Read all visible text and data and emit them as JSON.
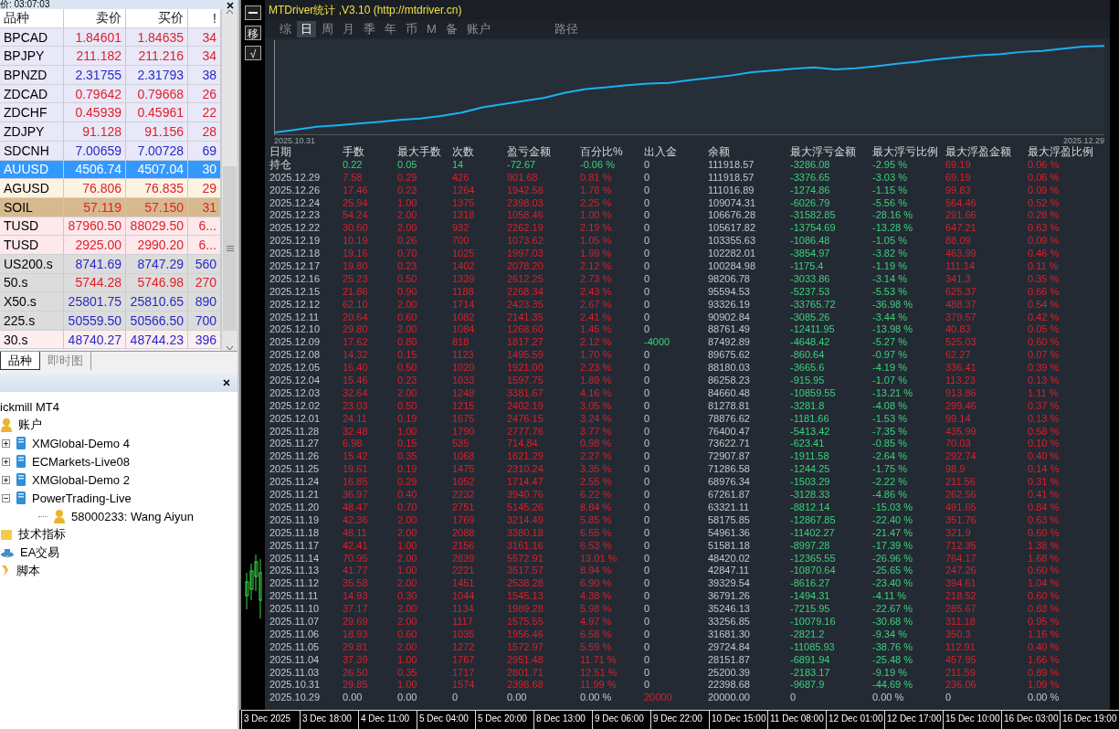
{
  "market_watch": {
    "title": "价: 03:07:03",
    "columns": [
      "品种",
      "卖价",
      "买价",
      "!"
    ],
    "rows": [
      {
        "symbol": "BPCAD",
        "bid": "1.84601",
        "ask": "1.84635",
        "spread": "34",
        "rising": false,
        "color": "#e8e8f8",
        "selected": false
      },
      {
        "symbol": "BPJPY",
        "bid": "211.182",
        "ask": "211.216",
        "spread": "34",
        "rising": false,
        "color": "#e8e8f8",
        "selected": false
      },
      {
        "symbol": "BPNZD",
        "bid": "2.31755",
        "ask": "2.31793",
        "spread": "38",
        "rising": true,
        "color": "#e8e8f8",
        "selected": false
      },
      {
        "symbol": "ZDCAD",
        "bid": "0.79642",
        "ask": "0.79668",
        "spread": "26",
        "rising": false,
        "color": "#e8e8f8",
        "selected": false
      },
      {
        "symbol": "ZDCHF",
        "bid": "0.45939",
        "ask": "0.45961",
        "spread": "22",
        "rising": false,
        "color": "#e8e8f8",
        "selected": false
      },
      {
        "symbol": "ZDJPY",
        "bid": "91.128",
        "ask": "91.156",
        "spread": "28",
        "rising": false,
        "color": "#e8e8f8",
        "selected": false
      },
      {
        "symbol": "SDCNH",
        "bid": "7.00659",
        "ask": "7.00728",
        "spread": "69",
        "rising": true,
        "color": "#e8e8f8",
        "selected": false
      },
      {
        "symbol": "AUUSD",
        "bid": "4506.74",
        "ask": "4507.04",
        "spread": "30",
        "selected": true
      },
      {
        "symbol": "AGUSD",
        "bid": "76.806",
        "ask": "76.835",
        "spread": "29",
        "rising": false,
        "color": "#fdf3e2",
        "selected": false
      },
      {
        "symbol": "SOIL",
        "bid": "57.119",
        "ask": "57.150",
        "spread": "31",
        "rising": false,
        "color": "#d7b98e",
        "selected": false
      },
      {
        "symbol": "TUSD",
        "bid": "87960.50",
        "ask": "88029.50",
        "spread": "6...",
        "rising": false,
        "color": "#fde8ec",
        "selected": false
      },
      {
        "symbol": "TUSD",
        "bid": "2925.00",
        "ask": "2990.20",
        "spread": "6...",
        "rising": false,
        "color": "#fde8ec",
        "selected": false
      },
      {
        "symbol": "US200.s",
        "bid": "8741.69",
        "ask": "8747.29",
        "spread": "560",
        "rising": true,
        "color": "#dcdcdc",
        "selected": false
      },
      {
        "symbol": "50.s",
        "bid": "5744.28",
        "ask": "5746.98",
        "spread": "270",
        "rising": false,
        "color": "#dcdcdc",
        "selected": false
      },
      {
        "symbol": "X50.s",
        "bid": "25801.75",
        "ask": "25810.65",
        "spread": "890",
        "rising": true,
        "color": "#dcdcdc",
        "selected": false
      },
      {
        "symbol": "225.s",
        "bid": "50559.50",
        "ask": "50566.50",
        "spread": "700",
        "rising": true,
        "color": "#dcdcdc",
        "selected": false
      },
      {
        "symbol": "30.s",
        "bid": "48740.27",
        "ask": "48744.23",
        "spread": "396",
        "rising": true,
        "color": "#fdeef0",
        "selected": false
      }
    ],
    "tabs": [
      {
        "label": "品种",
        "selected": true
      },
      {
        "label": "即时图",
        "selected": false
      }
    ]
  },
  "navigator": {
    "items": [
      {
        "label": "ickmill MT4",
        "kind": "root"
      },
      {
        "label": "账户",
        "kind": "accounts",
        "children": [
          {
            "label": "XMGlobal-Demo 4",
            "kind": "server",
            "expanded": false
          },
          {
            "label": "ECMarkets-Live08",
            "kind": "server",
            "expanded": false
          },
          {
            "label": "XMGlobal-Demo 2",
            "kind": "server",
            "expanded": false
          },
          {
            "label": "PowerTrading-Live",
            "kind": "server",
            "expanded": true,
            "children": [
              {
                "label": "58000233: Wang Aiyun",
                "kind": "user"
              }
            ]
          }
        ]
      },
      {
        "label": "技术指标",
        "kind": "indicators"
      },
      {
        "label": "EA交易",
        "kind": "experts"
      },
      {
        "label": "脚本",
        "kind": "scripts"
      }
    ]
  },
  "stats_panel": {
    "title": "MTDriver统计 ,V3.10 (http://mtdriver.cn)",
    "side_buttons": [
      "移",
      "√"
    ],
    "tabs": [
      {
        "label": "综",
        "selected": false
      },
      {
        "label": "日",
        "selected": true
      },
      {
        "label": "周",
        "selected": false
      },
      {
        "label": "月",
        "selected": false
      },
      {
        "label": "季",
        "selected": false
      },
      {
        "label": "年",
        "selected": false
      },
      {
        "label": "币",
        "selected": false
      },
      {
        "label": "M",
        "selected": false
      },
      {
        "label": "备",
        "selected": false
      },
      {
        "label": "账户",
        "selected": false
      },
      {
        "label": "路径",
        "selected": false
      }
    ],
    "chart": {
      "start_label": "2025.10.31",
      "end_label": "2025.12.29"
    },
    "columns": [
      "日期",
      "手数",
      "最大手数",
      "次数",
      "盈亏金额",
      "百分比%",
      "出入金",
      "余额",
      "最大浮亏金额",
      "最大浮亏比例",
      "最大浮盈金额",
      "最大浮盈比例"
    ],
    "rows": [
      {
        "kind": "open",
        "deposit": false,
        "withdrawal": false,
        "cells": [
          "持仓",
          "0.22",
          "0.05",
          "14",
          "-72.67",
          "-0.06 %",
          "0",
          "111918.57",
          "-3286.08",
          "-2.95 %",
          "69.19",
          "0.06 %"
        ]
      },
      {
        "kind": "day",
        "deposit": false,
        "withdrawal": false,
        "cells": [
          "2025.12.29",
          "7.58",
          "0.29",
          "426",
          "901.68",
          "0.81 %",
          "0",
          "111918.57",
          "-3376.65",
          "-3.03 %",
          "69.19",
          "0.06 %"
        ]
      },
      {
        "kind": "day",
        "deposit": false,
        "withdrawal": false,
        "cells": [
          "2025.12.26",
          "17.46",
          "0.23",
          "1264",
          "1942.58",
          "1.78 %",
          "0",
          "111016.89",
          "-1274.86",
          "-1.15 %",
          "99.83",
          "0.09 %"
        ]
      },
      {
        "kind": "day",
        "deposit": false,
        "withdrawal": false,
        "cells": [
          "2025.12.24",
          "25.94",
          "1.00",
          "1375",
          "2398.03",
          "2.25 %",
          "0",
          "109074.31",
          "-6026.79",
          "-5.56 %",
          "564.46",
          "0.52 %"
        ]
      },
      {
        "kind": "day",
        "deposit": false,
        "withdrawal": false,
        "cells": [
          "2025.12.23",
          "54.24",
          "2.00",
          "1318",
          "1058.46",
          "1.00 %",
          "0",
          "106676.28",
          "-31582.85",
          "-28.16 %",
          "291.66",
          "0.28 %"
        ]
      },
      {
        "kind": "day",
        "deposit": false,
        "withdrawal": false,
        "cells": [
          "2025.12.22",
          "30.60",
          "2.00",
          "932",
          "2262.19",
          "2.19 %",
          "0",
          "105617.82",
          "-13754.69",
          "-13.28 %",
          "647.21",
          "0.63 %"
        ]
      },
      {
        "kind": "day",
        "deposit": false,
        "withdrawal": false,
        "cells": [
          "2025.12.19",
          "10.19",
          "0.26",
          "700",
          "1073.62",
          "1.05 %",
          "0",
          "103355.63",
          "-1086.48",
          "-1.05 %",
          "88.09",
          "0.09 %"
        ]
      },
      {
        "kind": "day",
        "deposit": false,
        "withdrawal": false,
        "cells": [
          "2025.12.18",
          "19.16",
          "0.70",
          "1025",
          "1997.03",
          "1.99 %",
          "0",
          "102282.01",
          "-3854.97",
          "-3.82 %",
          "463.99",
          "0.46 %"
        ]
      },
      {
        "kind": "day",
        "deposit": false,
        "withdrawal": false,
        "cells": [
          "2025.12.17",
          "19.80",
          "0.23",
          "1402",
          "2078.20",
          "2.12 %",
          "0",
          "100284.98",
          "-1175.4",
          "-1.19 %",
          "111.14",
          "0.11 %"
        ]
      },
      {
        "kind": "day",
        "deposit": false,
        "withdrawal": false,
        "cells": [
          "2025.12.16",
          "25.23",
          "0.50",
          "1339",
          "2612.25",
          "2.73 %",
          "0",
          "98206.78",
          "-3033.86",
          "-3.14 %",
          "341.3",
          "0.35 %"
        ]
      },
      {
        "kind": "day",
        "deposit": false,
        "withdrawal": false,
        "cells": [
          "2025.12.15",
          "21.86",
          "0.90",
          "1188",
          "2268.34",
          "2.43 %",
          "0",
          "95594.53",
          "-5237.53",
          "-5.53 %",
          "625.37",
          "0.66 %"
        ]
      },
      {
        "kind": "day",
        "deposit": false,
        "withdrawal": false,
        "cells": [
          "2025.12.12",
          "62.10",
          "2.00",
          "1714",
          "2423.35",
          "2.67 %",
          "0",
          "93326.19",
          "-33765.72",
          "-36.98 %",
          "488.37",
          "0.54 %"
        ]
      },
      {
        "kind": "day",
        "deposit": false,
        "withdrawal": false,
        "cells": [
          "2025.12.11",
          "20.64",
          "0.60",
          "1082",
          "2141.35",
          "2.41 %",
          "0",
          "90902.84",
          "-3085.26",
          "-3.44 %",
          "379.57",
          "0.42 %"
        ]
      },
      {
        "kind": "day",
        "deposit": false,
        "withdrawal": false,
        "cells": [
          "2025.12.10",
          "29.80",
          "2.00",
          "1084",
          "1268.60",
          "1.45 %",
          "0",
          "88761.49",
          "-12411.95",
          "-13.98 %",
          "40.83",
          "0.05 %"
        ]
      },
      {
        "kind": "day",
        "deposit": false,
        "withdrawal": true,
        "cells": [
          "2025.12.09",
          "17.62",
          "0.80",
          "818",
          "1817.27",
          "2.12 %",
          "-4000",
          "87492.89",
          "-4648.42",
          "-5.27 %",
          "525.03",
          "0.60 %"
        ]
      },
      {
        "kind": "day",
        "deposit": false,
        "withdrawal": false,
        "cells": [
          "2025.12.08",
          "14.32",
          "0.15",
          "1123",
          "1495.59",
          "1.70 %",
          "0",
          "89675.62",
          "-860.64",
          "-0.97 %",
          "62.27",
          "0.07 %"
        ]
      },
      {
        "kind": "day",
        "deposit": false,
        "withdrawal": false,
        "cells": [
          "2025.12.05",
          "16.40",
          "0.50",
          "1020",
          "1921.00",
          "2.23 %",
          "0",
          "88180.03",
          "-3665.6",
          "-4.19 %",
          "336.41",
          "0.39 %"
        ]
      },
      {
        "kind": "day",
        "deposit": false,
        "withdrawal": false,
        "cells": [
          "2025.12.04",
          "15.46",
          "0.23",
          "1033",
          "1597.75",
          "1.89 %",
          "0",
          "86258.23",
          "-915.95",
          "-1.07 %",
          "113.23",
          "0.13 %"
        ]
      },
      {
        "kind": "day",
        "deposit": false,
        "withdrawal": false,
        "cells": [
          "2025.12.03",
          "32.64",
          "2.00",
          "1248",
          "3381.67",
          "4.16 %",
          "0",
          "84660.48",
          "-10859.55",
          "-13.21 %",
          "913.86",
          "1.11 %"
        ]
      },
      {
        "kind": "day",
        "deposit": false,
        "withdrawal": false,
        "cells": [
          "2025.12.02",
          "23.03",
          "0.50",
          "1215",
          "2402.19",
          "3.05 %",
          "0",
          "81278.81",
          "-3281.8",
          "-4.08 %",
          "299.46",
          "0.37 %"
        ]
      },
      {
        "kind": "day",
        "deposit": false,
        "withdrawal": false,
        "cells": [
          "2025.12.01",
          "24.11",
          "0.19",
          "1675",
          "2476.15",
          "3.24 %",
          "0",
          "78876.62",
          "-1181.66",
          "-1.53 %",
          "99.14",
          "0.13 %"
        ]
      },
      {
        "kind": "day",
        "deposit": false,
        "withdrawal": false,
        "cells": [
          "2025.11.28",
          "32.48",
          "1.00",
          "1790",
          "2777.76",
          "3.77 %",
          "0",
          "76400.47",
          "-5413.42",
          "-7.35 %",
          "435.99",
          "0.58 %"
        ]
      },
      {
        "kind": "day",
        "deposit": false,
        "withdrawal": false,
        "cells": [
          "2025.11.27",
          "6.98",
          "0.15",
          "535",
          "714.84",
          "0.98 %",
          "0",
          "73622.71",
          "-623.41",
          "-0.85 %",
          "70.03",
          "0.10 %"
        ]
      },
      {
        "kind": "day",
        "deposit": false,
        "withdrawal": false,
        "cells": [
          "2025.11.26",
          "15.42",
          "0.35",
          "1068",
          "1621.29",
          "2.27 %",
          "0",
          "72907.87",
          "-1911.58",
          "-2.64 %",
          "292.74",
          "0.40 %"
        ]
      },
      {
        "kind": "day",
        "deposit": false,
        "withdrawal": false,
        "cells": [
          "2025.11.25",
          "19.61",
          "0.19",
          "1475",
          "2310.24",
          "3.35 %",
          "0",
          "71286.58",
          "-1244.25",
          "-1.75 %",
          "98.9",
          "0.14 %"
        ]
      },
      {
        "kind": "day",
        "deposit": false,
        "withdrawal": false,
        "cells": [
          "2025.11.24",
          "16.85",
          "0.29",
          "1052",
          "1714.47",
          "2.55 %",
          "0",
          "68976.34",
          "-1503.29",
          "-2.22 %",
          "211.56",
          "0.31 %"
        ]
      },
      {
        "kind": "day",
        "deposit": false,
        "withdrawal": false,
        "cells": [
          "2025.11.21",
          "36.97",
          "0.40",
          "2232",
          "3940.76",
          "6.22 %",
          "0",
          "67261.87",
          "-3128.33",
          "-4.86 %",
          "262.56",
          "0.41 %"
        ]
      },
      {
        "kind": "day",
        "deposit": false,
        "withdrawal": false,
        "cells": [
          "2025.11.20",
          "48.47",
          "0.70",
          "2751",
          "5145.26",
          "8.84 %",
          "0",
          "63321.11",
          "-8812.14",
          "-15.03 %",
          "491.65",
          "0.84 %"
        ]
      },
      {
        "kind": "day",
        "deposit": false,
        "withdrawal": false,
        "cells": [
          "2025.11.19",
          "42.36",
          "2.00",
          "1769",
          "3214.49",
          "5.85 %",
          "0",
          "58175.85",
          "-12867.85",
          "-22.40 %",
          "351.76",
          "0.63 %"
        ]
      },
      {
        "kind": "day",
        "deposit": false,
        "withdrawal": false,
        "cells": [
          "2025.11.18",
          "48.11",
          "2.00",
          "2088",
          "3380.18",
          "6.55 %",
          "0",
          "54961.36",
          "-11402.27",
          "-21.47 %",
          "321.9",
          "0.60 %"
        ]
      },
      {
        "kind": "day",
        "deposit": false,
        "withdrawal": false,
        "cells": [
          "2025.11.17",
          "42.41",
          "1.00",
          "2156",
          "3161.16",
          "6.53 %",
          "0",
          "51581.18",
          "-8997.28",
          "-17.39 %",
          "712.35",
          "1.38 %"
        ]
      },
      {
        "kind": "day",
        "deposit": false,
        "withdrawal": false,
        "cells": [
          "2025.11.14",
          "70.95",
          "2.00",
          "2839",
          "5572.91",
          "13.01 %",
          "0",
          "48420.02",
          "-12365.55",
          "-26.96 %",
          "764.17",
          "1.68 %"
        ]
      },
      {
        "kind": "day",
        "deposit": false,
        "withdrawal": false,
        "cells": [
          "2025.11.13",
          "41.77",
          "1.00",
          "2221",
          "3517.57",
          "8.94 %",
          "0",
          "42847.11",
          "-10870.64",
          "-25.65 %",
          "247.26",
          "0.60 %"
        ]
      },
      {
        "kind": "day",
        "deposit": false,
        "withdrawal": false,
        "cells": [
          "2025.11.12",
          "35.58",
          "2.00",
          "1451",
          "2538.28",
          "6.90 %",
          "0",
          "39329.54",
          "-8616.27",
          "-23.40 %",
          "394.61",
          "1.04 %"
        ]
      },
      {
        "kind": "day",
        "deposit": false,
        "withdrawal": false,
        "cells": [
          "2025.11.11",
          "14.93",
          "0.30",
          "1044",
          "1545.13",
          "4.38 %",
          "0",
          "36791.26",
          "-1494.31",
          "-4.11 %",
          "218.52",
          "0.60 %"
        ]
      },
      {
        "kind": "day",
        "deposit": false,
        "withdrawal": false,
        "cells": [
          "2025.11.10",
          "37.17",
          "2.00",
          "1134",
          "1989.28",
          "5.98 %",
          "0",
          "35246.13",
          "-7215.95",
          "-22.67 %",
          "285.67",
          "0.83 %"
        ]
      },
      {
        "kind": "day",
        "deposit": false,
        "withdrawal": false,
        "cells": [
          "2025.11.07",
          "29.69",
          "2.00",
          "1117",
          "1575.55",
          "4.97 %",
          "0",
          "33256.85",
          "-10079.16",
          "-30.68 %",
          "311.18",
          "0.95 %"
        ]
      },
      {
        "kind": "day",
        "deposit": false,
        "withdrawal": false,
        "cells": [
          "2025.11.06",
          "18.93",
          "0.60",
          "1035",
          "1956.46",
          "6.58 %",
          "0",
          "31681.30",
          "-2821.2",
          "-9.34 %",
          "350.3",
          "1.16 %"
        ]
      },
      {
        "kind": "day",
        "deposit": false,
        "withdrawal": false,
        "cells": [
          "2025.11.05",
          "29.81",
          "2.00",
          "1272",
          "1572.97",
          "5.59 %",
          "0",
          "29724.84",
          "-11085.93",
          "-38.76 %",
          "112.91",
          "0.40 %"
        ]
      },
      {
        "kind": "day",
        "deposit": false,
        "withdrawal": false,
        "cells": [
          "2025.11.04",
          "37.39",
          "1.00",
          "1767",
          "2951.48",
          "11.71 %",
          "0",
          "28151.87",
          "-6891.94",
          "-25.48 %",
          "457.95",
          "1.66 %"
        ]
      },
      {
        "kind": "day",
        "deposit": false,
        "withdrawal": false,
        "cells": [
          "2025.11.03",
          "26.50",
          "0.35",
          "1717",
          "2801.71",
          "12.51 %",
          "0",
          "25200.39",
          "-2183.17",
          "-9.19 %",
          "211.59",
          "0.89 %"
        ]
      },
      {
        "kind": "day",
        "deposit": false,
        "withdrawal": false,
        "cells": [
          "2025.10.31",
          "29.85",
          "1.00",
          "1574",
          "2398.68",
          "11.99 %",
          "0",
          "22398.68",
          "-9687.9",
          "-44.69 %",
          "236.06",
          "1.09 %"
        ]
      },
      {
        "kind": "start",
        "deposit": true,
        "withdrawal": false,
        "cells": [
          "2025.10.29",
          "0.00",
          "0.00",
          "0",
          "0.00",
          "0.00 %",
          "20000",
          "20000.00",
          "0",
          "0.00 %",
          "0",
          "0.00 %"
        ]
      }
    ]
  },
  "time_axis": [
    "3 Dec 2025",
    "3 Dec 18:00",
    "4 Dec 11:00",
    "5 Dec 04:00",
    "5 Dec 20:00",
    "8 Dec 13:00",
    "9 Dec 06:00",
    "9 Dec 22:00",
    "10 Dec 15:00",
    "11 Dec 08:00",
    "12 Dec 01:00",
    "12 Dec 17:00",
    "15 Dec 10:00",
    "16 Dec 03:00",
    "16 Dec 19:00"
  ]
}
